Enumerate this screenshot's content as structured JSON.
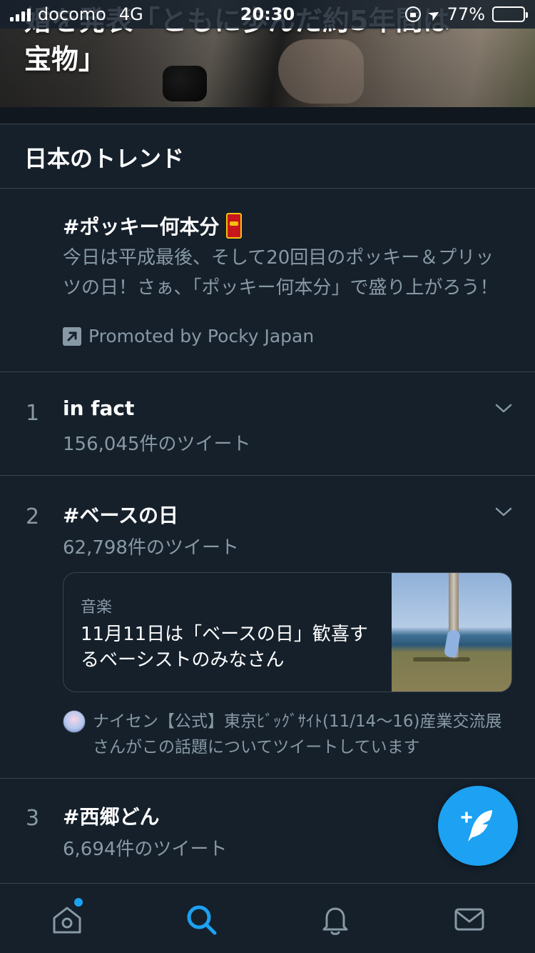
{
  "status_bar": {
    "carrier": "docomo",
    "network": "4G",
    "time": "20:30",
    "battery": "77%",
    "battery_level": 0.77
  },
  "hero": {
    "headline_line1": "婚を発表「ともに歩んだ約5年間は",
    "headline_line2": "宝物」"
  },
  "section_title": "日本のトレンド",
  "promoted": {
    "title": "#ポッキー何本分",
    "description": "今日は平成最後、そして20回目のポッキー＆プリッツの日！さぁ、「ポッキー何本分」で盛り上がろう！",
    "promoted_by": "Promoted by Pocky Japan"
  },
  "trends": [
    {
      "rank": "1",
      "name": "in fact",
      "count": "156,045件のツイート"
    },
    {
      "rank": "2",
      "name": "#ベースの日",
      "count": "62,798件のツイート"
    },
    {
      "rank": "3",
      "name": "#西郷どん",
      "count": "6,694件のツイート"
    }
  ],
  "card": {
    "category": "音楽",
    "title": "11月11日は「ベースの日」歓喜するベーシストのみなさん"
  },
  "social_context": "ナイセン【公式】東京ﾋﾞｯｸﾞｻｲﾄ(11/14～16)産業交流展さんがこの話題についてツイートしています",
  "colors": {
    "background": "#15202b",
    "divider": "#38444d",
    "secondary_text": "#8899a6",
    "accent": "#1da1f2"
  },
  "tabs": [
    "home-icon",
    "search-icon",
    "bell-icon",
    "mail-icon"
  ]
}
